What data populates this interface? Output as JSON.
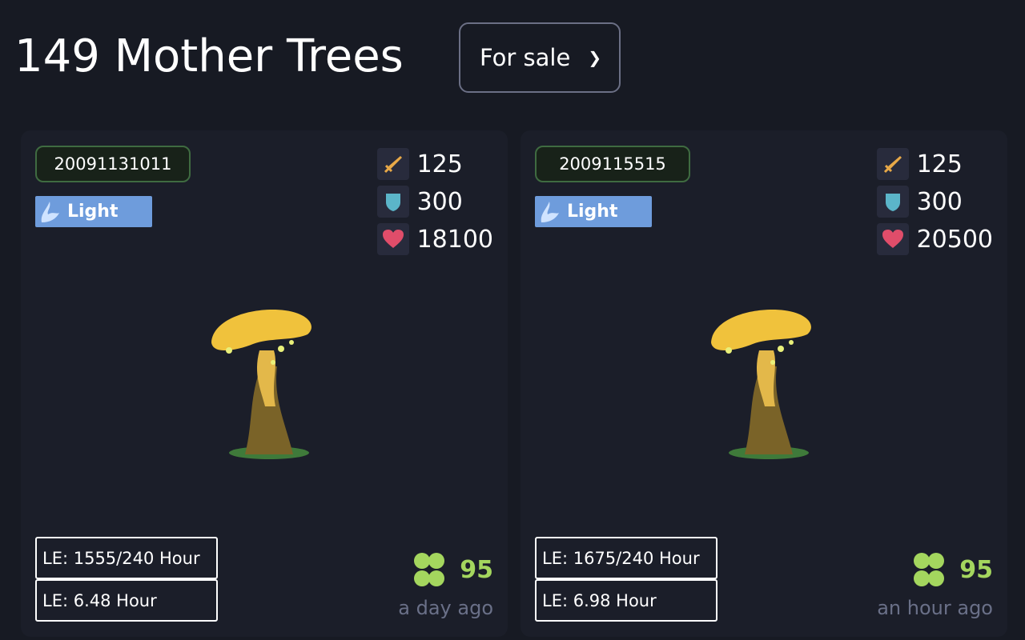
{
  "header": {
    "title": "149 Mother Trees",
    "filter": "For sale"
  },
  "cards": [
    {
      "id": "20091131011",
      "element": "Light",
      "attack": "125",
      "defense": "300",
      "hp": "18100",
      "le_total": "LE: 1555/240 Hour",
      "le_rate": "LE: 6.48 Hour",
      "luck": "95",
      "listed": "a day ago"
    },
    {
      "id": "2009115515",
      "element": "Light",
      "attack": "125",
      "defense": "300",
      "hp": "20500",
      "le_total": "LE: 1675/240 Hour",
      "le_rate": "LE: 6.98 Hour",
      "luck": "95",
      "listed": "an hour ago"
    }
  ],
  "colors": {
    "element_light": "#6e9cdc",
    "luck": "#a4d65e",
    "id_border": "#3f6b41"
  }
}
